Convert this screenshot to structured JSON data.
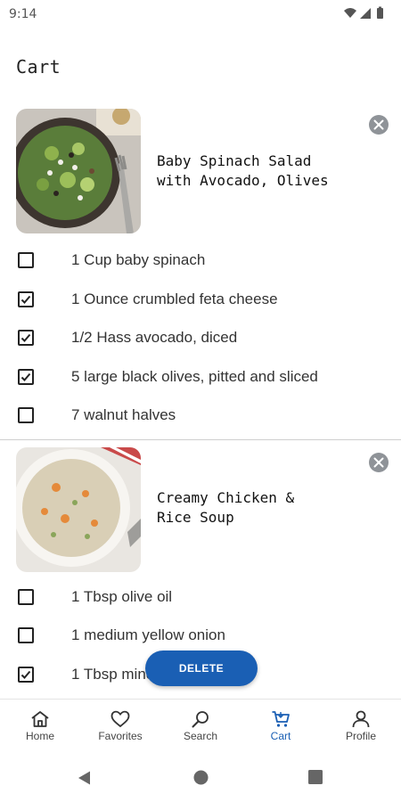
{
  "status": {
    "time": "9:14"
  },
  "page": {
    "title": "Cart"
  },
  "recipes": [
    {
      "title_lines": [
        "Baby Spinach Salad",
        "with Avocado, Olives"
      ],
      "ingredients": [
        {
          "label": "1 Cup baby spinach",
          "checked": false
        },
        {
          "label": "1 Ounce crumbled feta cheese",
          "checked": true
        },
        {
          "label": "1/2 Hass avocado, diced",
          "checked": true
        },
        {
          "label": "5 large black olives, pitted and sliced",
          "checked": true
        },
        {
          "label": "7 walnut halves",
          "checked": false
        }
      ]
    },
    {
      "title_lines": [
        "Creamy Chicken &",
        "Rice Soup"
      ],
      "ingredients": [
        {
          "label": "1 Tbsp olive oil",
          "checked": false
        },
        {
          "label": "1 medium yellow onion",
          "checked": false
        },
        {
          "label": "1 Tbsp minced garlic",
          "checked": true
        }
      ]
    }
  ],
  "fab": {
    "label": "DELETE"
  },
  "nav": {
    "items": [
      {
        "label": "Home",
        "icon": "home-icon"
      },
      {
        "label": "Favorites",
        "icon": "heart-icon"
      },
      {
        "label": "Search",
        "icon": "search-icon"
      },
      {
        "label": "Cart",
        "icon": "cart-icon",
        "active": true
      },
      {
        "label": "Profile",
        "icon": "person-icon"
      }
    ]
  },
  "colors": {
    "accent": "#1a5fb4",
    "remove": "#8f9398"
  }
}
